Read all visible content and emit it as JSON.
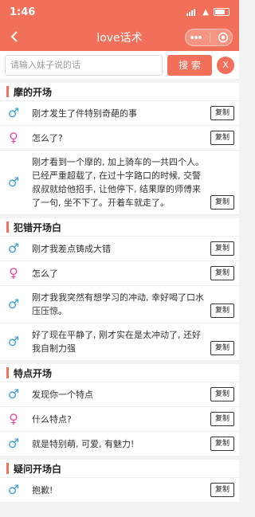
{
  "status": {
    "time": "1:46"
  },
  "nav": {
    "title": "love话术"
  },
  "search": {
    "placeholder": "请输入妹子说的话",
    "button_label": "搜 索",
    "close_label": "X"
  },
  "copy_label": "复制",
  "sections": [
    {
      "title": "摩的开场",
      "rows": [
        {
          "gender": "male",
          "text": "刚才发生了件特别奇葩的事"
        },
        {
          "gender": "female",
          "text": "怎么了?"
        },
        {
          "gender": "male",
          "text": "刚才看到一个摩的, 加上骑车的一共四个人。已经严重超载了, 在过十字路口的时候, 交警叔叔就给他招手, 让他停下, 结果摩的师傅来了一句, 坐不下了。开着车就走了。"
        }
      ]
    },
    {
      "title": "犯错开场白",
      "rows": [
        {
          "gender": "male",
          "text": "刚才我差点铸成大错"
        },
        {
          "gender": "female",
          "text": "怎么了"
        },
        {
          "gender": "male",
          "text": "刚才我我突然有想学习的冲动, 幸好喝了口水压压惊。"
        },
        {
          "gender": "male",
          "text": "好了现在平静了, 刚才实在是太冲动了, 还好我自制力强"
        }
      ]
    },
    {
      "title": "特点开场",
      "rows": [
        {
          "gender": "male",
          "text": "发现你一个特点"
        },
        {
          "gender": "female",
          "text": "什么特点?"
        },
        {
          "gender": "male",
          "text": "就是特别萌, 可爱, 有魅力!"
        }
      ]
    },
    {
      "title": "疑问开场白",
      "rows": [
        {
          "gender": "male",
          "text": "抱歉!"
        }
      ]
    }
  ]
}
